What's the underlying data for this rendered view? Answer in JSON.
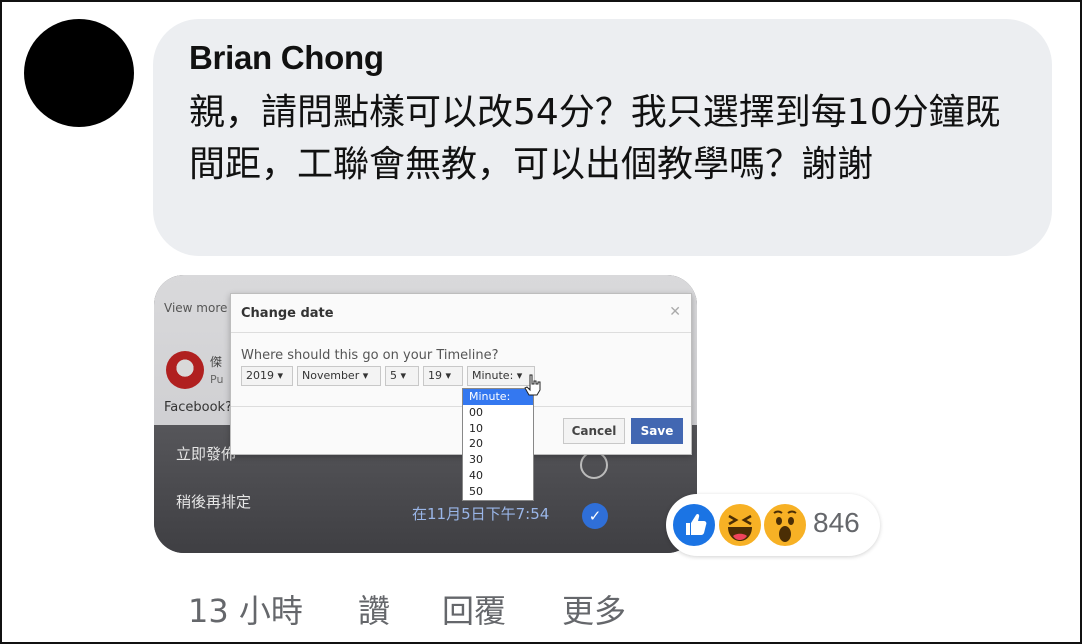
{
  "comment": {
    "author": "Brian Chong",
    "text": "親，請問點樣可以改54分？我只選擇到每10分鐘既間距，工聯會無教，可以出個教學嗎？謝謝"
  },
  "attachment": {
    "background": {
      "view_more": "View more",
      "post_name": "傑",
      "post_sub": "Pu",
      "facebook_line": "Facebook?",
      "option_now": "立即發佈",
      "option_later": "稍後再排定",
      "scheduled_time": "在11月5日下午7:54"
    },
    "dialog": {
      "title": "Change date",
      "question": "Where should this go on your Timeline?",
      "year": "2019",
      "month": "November",
      "day": "5",
      "hour": "19",
      "minute": "Minute:",
      "cancel_label": "Cancel",
      "save_label": "Save",
      "minute_options": [
        "Minute:",
        "00",
        "10",
        "20",
        "30",
        "40",
        "50"
      ]
    }
  },
  "reactions": {
    "icons": [
      "like-icon",
      "haha-icon",
      "wow-icon"
    ],
    "count": "846",
    "colors": {
      "like": "#1b74e4",
      "haha": "#f7b125",
      "wow": "#f7b125"
    }
  },
  "actions": {
    "time": "13 小時",
    "like": "讚",
    "reply": "回覆",
    "more": "更多"
  }
}
